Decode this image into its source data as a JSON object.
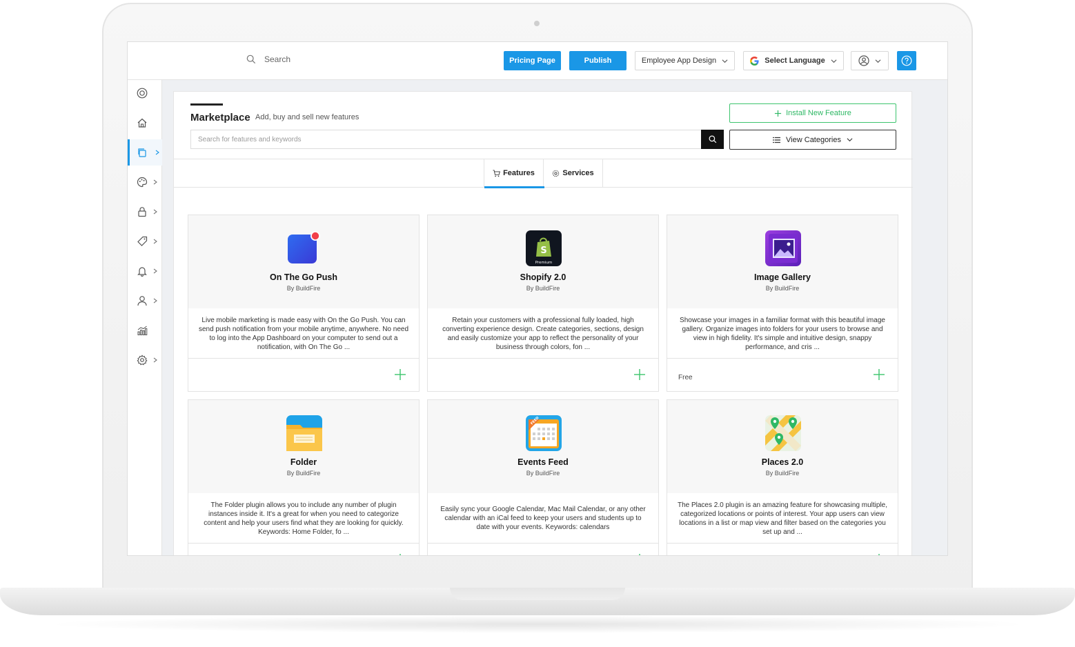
{
  "topbar": {
    "search_placeholder": "Search",
    "pricing_label": "Pricing Page",
    "publish_label": "Publish",
    "app_selector": "Employee App Design",
    "language_label": "Select Language"
  },
  "colors": {
    "primary_blue": "#1a97e6",
    "install_green": "#2fb865",
    "dark": "#111111"
  },
  "sidebar": {
    "items": [
      {
        "icon": "lifebuoy-icon"
      },
      {
        "icon": "home-icon"
      },
      {
        "icon": "plugins-icon",
        "active": true
      },
      {
        "icon": "palette-icon"
      },
      {
        "icon": "lock-icon"
      },
      {
        "icon": "tag-icon"
      },
      {
        "icon": "bell-icon"
      },
      {
        "icon": "user-icon"
      },
      {
        "icon": "analytics-icon"
      },
      {
        "icon": "gear-icon"
      }
    ]
  },
  "marketplace": {
    "title": "Marketplace",
    "subtitle": "Add, buy and sell new features",
    "search_placeholder": "Search for features and keywords",
    "install_label": "Install New Feature",
    "categories_label": "View Categories",
    "tabs": [
      {
        "label": "Features",
        "active": true
      },
      {
        "label": "Services",
        "active": false
      }
    ]
  },
  "cards": [
    {
      "name": "On The Go Push",
      "author": "By BuildFire",
      "description": "Live mobile marketing is made easy with On the Go Push. You can send push notification from your mobile anytime, anywhere. No need to log into the App Dashboard on your computer to send out a notification, with On The Go ...",
      "price": "",
      "icon": "push-icon"
    },
    {
      "name": "Shopify 2.0",
      "author": "By BuildFire",
      "description": "Retain your customers with a professional fully loaded, high converting experience design. Create categories, sections, design and easily customize your app to reflect the personality of your business through colors, fon ...",
      "price": "",
      "icon": "shopify-icon",
      "icon_badge": "Premium"
    },
    {
      "name": "Image Gallery",
      "author": "By BuildFire",
      "description": "Showcase your images in a familiar format with this beautiful image gallery. Organize images into folders for your users to browse and view in high fidelity. It's simple and intuitive design, snappy performance, and cris ...",
      "price": "Free",
      "icon": "gallery-icon"
    },
    {
      "name": "Folder",
      "author": "By BuildFire",
      "description": "The Folder plugin allows you to include any number of plugin instances inside it. It's a great for when you need to categorize content and help your users find what they are looking for quickly. Keywords: Home Folder, fo ...",
      "price": "",
      "icon": "folder-icon"
    },
    {
      "name": "Events Feed",
      "author": "By BuildFire",
      "description": "Easily sync your Google Calendar, Mac Mail Calendar, or any other calendar with an iCal feed to keep your users and students up to date with your events. Keywords: calendars",
      "price": "",
      "icon": "calendar-icon",
      "icon_badge": "FEED"
    },
    {
      "name": "Places 2.0",
      "author": "By BuildFire",
      "description": "The Places 2.0 plugin is an amazing feature for showcasing multiple, categorized locations or points of interest. Your app users can view locations in a list or map view and filter based on the categories you set up and ...",
      "price": "",
      "icon": "map-icon"
    }
  ]
}
